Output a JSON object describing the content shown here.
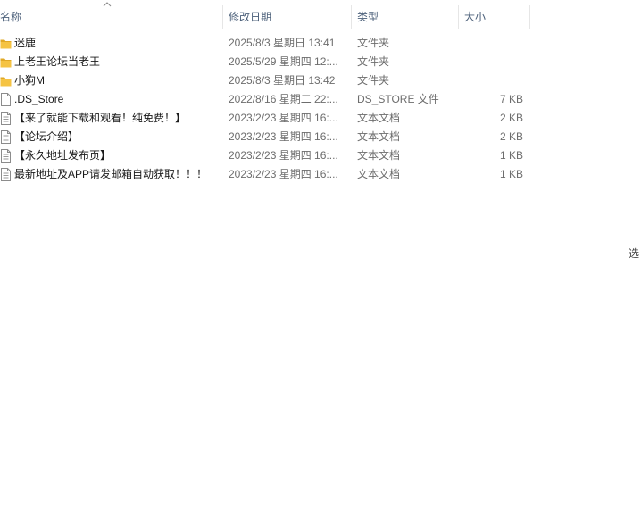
{
  "columns": {
    "name": "名称",
    "date": "修改日期",
    "type": "类型",
    "size": "大小"
  },
  "files": [
    {
      "icon": "folder-icon",
      "name": "迷鹿",
      "date": "2025/8/3 星期日 13:41",
      "type": "文件夹",
      "size": ""
    },
    {
      "icon": "folder-icon",
      "name": "上老王论坛当老王",
      "date": "2025/5/29 星期四 12:...",
      "type": "文件夹",
      "size": ""
    },
    {
      "icon": "folder-icon",
      "name": "小狗M",
      "date": "2025/8/3 星期日 13:42",
      "type": "文件夹",
      "size": ""
    },
    {
      "icon": "blank-file-icon",
      "name": ".DS_Store",
      "date": "2022/8/16 星期二 22:...",
      "type": "DS_STORE 文件",
      "size": "7 KB"
    },
    {
      "icon": "text-document-icon",
      "name": "【来了就能下载和观看！纯免费！】",
      "date": "2023/2/23 星期四 16:...",
      "type": "文本文档",
      "size": "2 KB"
    },
    {
      "icon": "text-document-icon",
      "name": "【论坛介绍】",
      "date": "2023/2/23 星期四 16:...",
      "type": "文本文档",
      "size": "2 KB"
    },
    {
      "icon": "text-document-icon",
      "name": "【永久地址发布页】",
      "date": "2023/2/23 星期四 16:...",
      "type": "文本文档",
      "size": "1 KB"
    },
    {
      "icon": "text-document-icon",
      "name": "最新地址及APP请发邮箱自动获取！！！",
      "date": "2023/2/23 星期四 16:...",
      "type": "文本文档",
      "size": "1 KB"
    }
  ],
  "preview_pane": {
    "hint": "选"
  },
  "colors": {
    "header_text": "#4c607a",
    "folder": "#f5c343",
    "folder_dark": "#e0a826",
    "detail_text": "#6d6d6d"
  }
}
